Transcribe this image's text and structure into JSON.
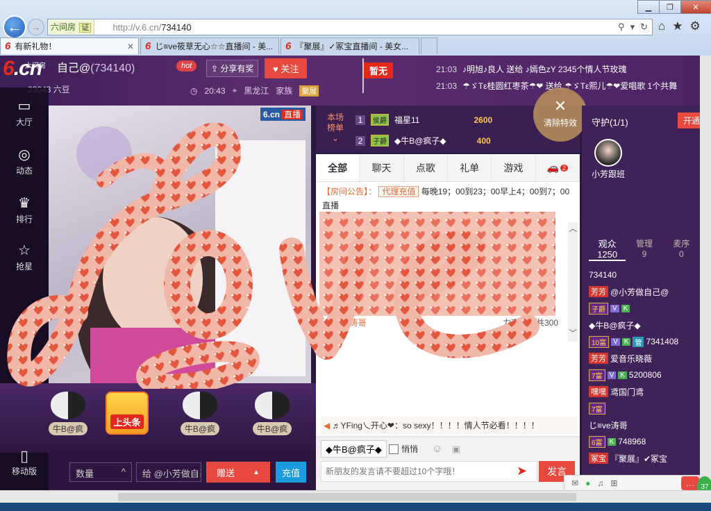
{
  "browser": {
    "site_badge": "六间房",
    "cert": "证",
    "url_host": "http://v.6.cn/",
    "url_path": "734140",
    "tabs": [
      {
        "label": "有新礼物！",
        "active": true
      },
      {
        "label": "じ≡ve筱草无心☆☆直播间 - 美...",
        "active": false
      },
      {
        "label": "『聚展』✓冢宝直播间 - 美女...",
        "active": false
      }
    ]
  },
  "header": {
    "logo": "6.cn",
    "logo_sub": "六间房",
    "anchor_name": "自己@",
    "room_id": "(734140)",
    "anchor_sub": "23043 六豆",
    "hot": "hot",
    "share": "分享有奖",
    "follow": "关注",
    "time": "20:43",
    "location": "黑龙江",
    "family_label": "家族",
    "family_tag": "聚展",
    "flag": "暂无",
    "ticker": [
      {
        "time": "21:03",
        "text": "♪明旭♪良人 送给 ♪嫣色zY 2345个情人节玫瑰"
      },
      {
        "time": "21:03",
        "text": "☂ゞTε桂圆红枣茶☂❤ 送给 ☂ゞTε熙儿☂❤爱唱歌 1个共舞"
      }
    ]
  },
  "sidebar": {
    "items": [
      "大厅",
      "动态",
      "排行",
      "抢星"
    ],
    "mobile": "移动版"
  },
  "video": {
    "brand": "6.cn",
    "live": "直播",
    "top_tag": "上头条",
    "gift_labels": [
      "牛B@疯",
      "牛B@疯",
      "牛B@疯"
    ]
  },
  "send": {
    "qty_placeholder": "数量",
    "recipient": "给 @小芳做自己",
    "give": "赠送",
    "charge": "充值"
  },
  "rank": {
    "title": "本场榜单",
    "rows": [
      {
        "no": "1",
        "badge": "侯爵",
        "name": "福星11",
        "coins": "2600"
      },
      {
        "no": "2",
        "badge": "子爵",
        "name": "◆牛B@疯子◆",
        "coins": "400"
      }
    ],
    "clear": "清除特效",
    "car_count": "2"
  },
  "chat": {
    "tabs": [
      "全部",
      "聊天",
      "点歌",
      "礼单",
      "游戏"
    ],
    "notice_head": "【房间公告】：",
    "notice_btn": "代理充值",
    "notice_text": "每晚19；00到23；00早上4；00到7；00直播",
    "frag_right": "力亮力，共300",
    "frag_left": "个，感",
    "frag_name": "涛哥",
    "sys_user": "♬YFing乀开心❤",
    "sys_text": "：so sexy！！！！情人节必看！！！！",
    "target": "◆牛B@疯子◆",
    "whisper": "悄悄",
    "input_placeholder": "新朋友的发言请不要超过10个字哦！",
    "send": "发言"
  },
  "right": {
    "guard_title": "守护(1/1)",
    "open_btn": "开通",
    "guard_name": "小芳跟班",
    "tabs": [
      {
        "label": "观众",
        "count": "1250"
      },
      {
        "label": "管理",
        "count": "9"
      },
      {
        "label": "麦序",
        "count": "0"
      }
    ],
    "users": [
      {
        "line1": "734140",
        "tag": "芳芳",
        "name": "@小芳做自己@"
      },
      {
        "badge": "子爵",
        "name": "◆牛B@疯子◆"
      },
      {
        "lv": "10富",
        "id": "7341408",
        "tag": "芳芳",
        "name": "爱音乐晓薇"
      },
      {
        "lv": "7富",
        "id": "5200806",
        "tag": "嘿嘿",
        "name": "鸢国门鸢"
      },
      {
        "lv": "7富",
        "name": "じ≡ve涛哥"
      },
      {
        "lv": "6富",
        "id": "748968",
        "tag": "冢宝",
        "name": "『聚展』✔冢宝"
      }
    ]
  },
  "overlay": {
    "word": "Love"
  }
}
